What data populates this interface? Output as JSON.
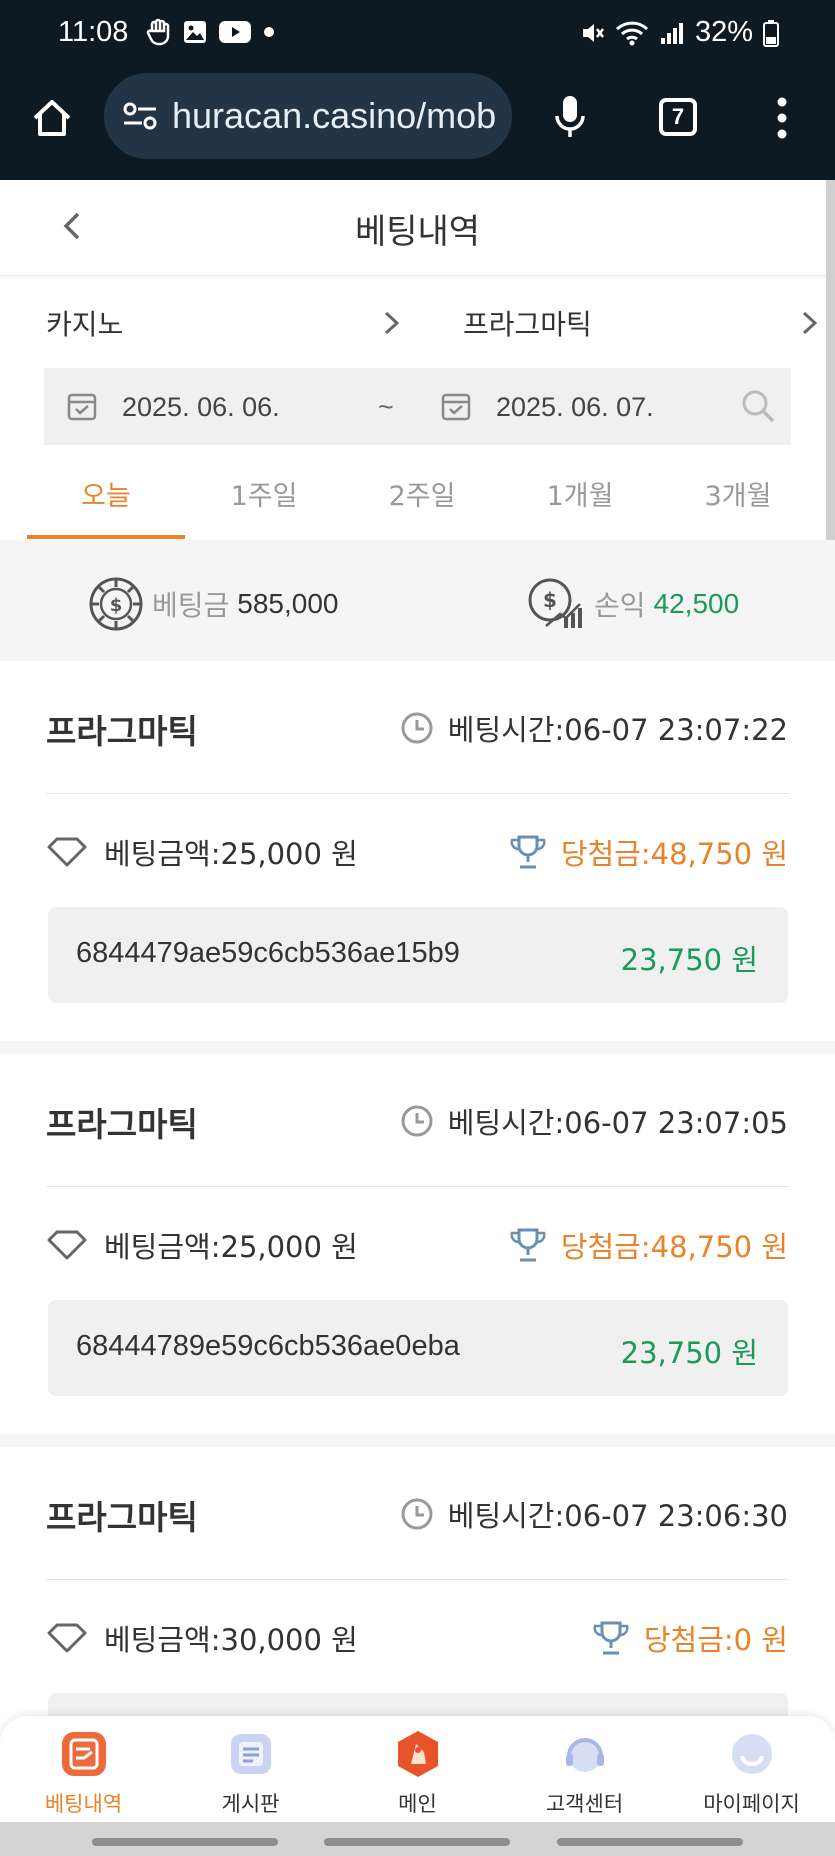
{
  "status_bar": {
    "time": "11:08",
    "battery": "32%"
  },
  "browser": {
    "url": "huracan.casino/mob",
    "tab_count": "7"
  },
  "header": {
    "title": "베팅내역"
  },
  "filters": {
    "category": "카지노",
    "provider": "프라그마틱"
  },
  "date_range": {
    "start": "2025. 06. 06.",
    "separator": "~",
    "end": "2025. 06. 07."
  },
  "period_tabs": [
    {
      "label": "오늘"
    },
    {
      "label": "1주일"
    },
    {
      "label": "2주일"
    },
    {
      "label": "1개월"
    },
    {
      "label": "3개월"
    }
  ],
  "summary": {
    "bet_label": "베팅금",
    "bet_value": "585,000",
    "profit_label": "손익",
    "profit_value": "42,500"
  },
  "bets": [
    {
      "provider": "프라그마틱",
      "time": "베팅시간:06-07 23:07:22",
      "bet_amount": "베팅금액:25,000 원",
      "win_amount": "당첨금:48,750 원",
      "hash": "6844479ae59c6cb536ae15b9",
      "result": "23,750 원"
    },
    {
      "provider": "프라그마틱",
      "time": "베팅시간:06-07 23:07:05",
      "bet_amount": "베팅금액:25,000 원",
      "win_amount": "당첨금:48,750 원",
      "hash": "68444789e59c6cb536ae0eba",
      "result": "23,750 원"
    },
    {
      "provider": "프라그마틱",
      "time": "베팅시간:06-07 23:06:30",
      "bet_amount": "베팅금액:30,000 원",
      "win_amount": "당첨금:0 원"
    }
  ],
  "bottom_nav": [
    {
      "label": "베팅내역"
    },
    {
      "label": "게시판"
    },
    {
      "label": "메인"
    },
    {
      "label": "고객센터"
    },
    {
      "label": "마이페이지"
    }
  ],
  "colors": {
    "accent": "#e8832a",
    "profit_green": "#1a9a5a",
    "chrome_bg": "#0e1a23"
  }
}
